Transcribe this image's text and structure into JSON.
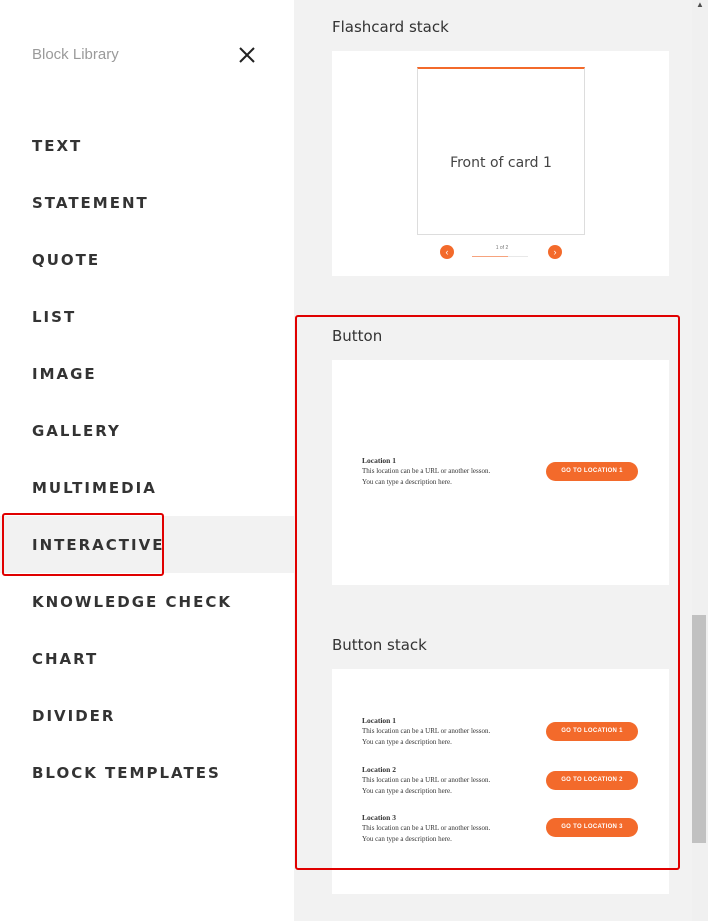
{
  "sidebar": {
    "title": "Block Library",
    "close_icon": "close-icon",
    "items": [
      {
        "label": "TEXT"
      },
      {
        "label": "STATEMENT"
      },
      {
        "label": "QUOTE"
      },
      {
        "label": "LIST"
      },
      {
        "label": "IMAGE"
      },
      {
        "label": "GALLERY"
      },
      {
        "label": "MULTIMEDIA"
      },
      {
        "label": "INTERACTIVE",
        "active": true
      },
      {
        "label": "KNOWLEDGE CHECK"
      },
      {
        "label": "CHART"
      },
      {
        "label": "DIVIDER"
      },
      {
        "label": "BLOCK TEMPLATES"
      }
    ]
  },
  "main": {
    "flashcard": {
      "title": "Flashcard stack",
      "card_text": "Front of card 1",
      "counter": "1 of 2",
      "prev_icon": "chevron-left-icon",
      "next_icon": "chevron-right-icon"
    },
    "button": {
      "title": "Button",
      "location": {
        "title": "Location 1",
        "desc_line1": "This location can be a URL or another lesson.",
        "desc_line2": "You can type a description here.",
        "button_label": "GO TO LOCATION 1"
      }
    },
    "button_stack": {
      "title": "Button stack",
      "locations": [
        {
          "title": "Location 1",
          "desc_line1": "This location can be a URL or another lesson.",
          "desc_line2": "You can type a description here.",
          "button_label": "GO TO LOCATION 1"
        },
        {
          "title": "Location 2",
          "desc_line1": "This location can be a URL or another lesson.",
          "desc_line2": "You can type a description here.",
          "button_label": "GO TO LOCATION 2"
        },
        {
          "title": "Location 3",
          "desc_line1": "This location can be a URL or another lesson.",
          "desc_line2": "You can type a description here.",
          "button_label": "GO TO LOCATION 3"
        }
      ]
    }
  },
  "colors": {
    "accent": "#f36a2b",
    "highlight": "#e00000",
    "panel_bg": "#f2f2f2",
    "text": "#333333"
  }
}
